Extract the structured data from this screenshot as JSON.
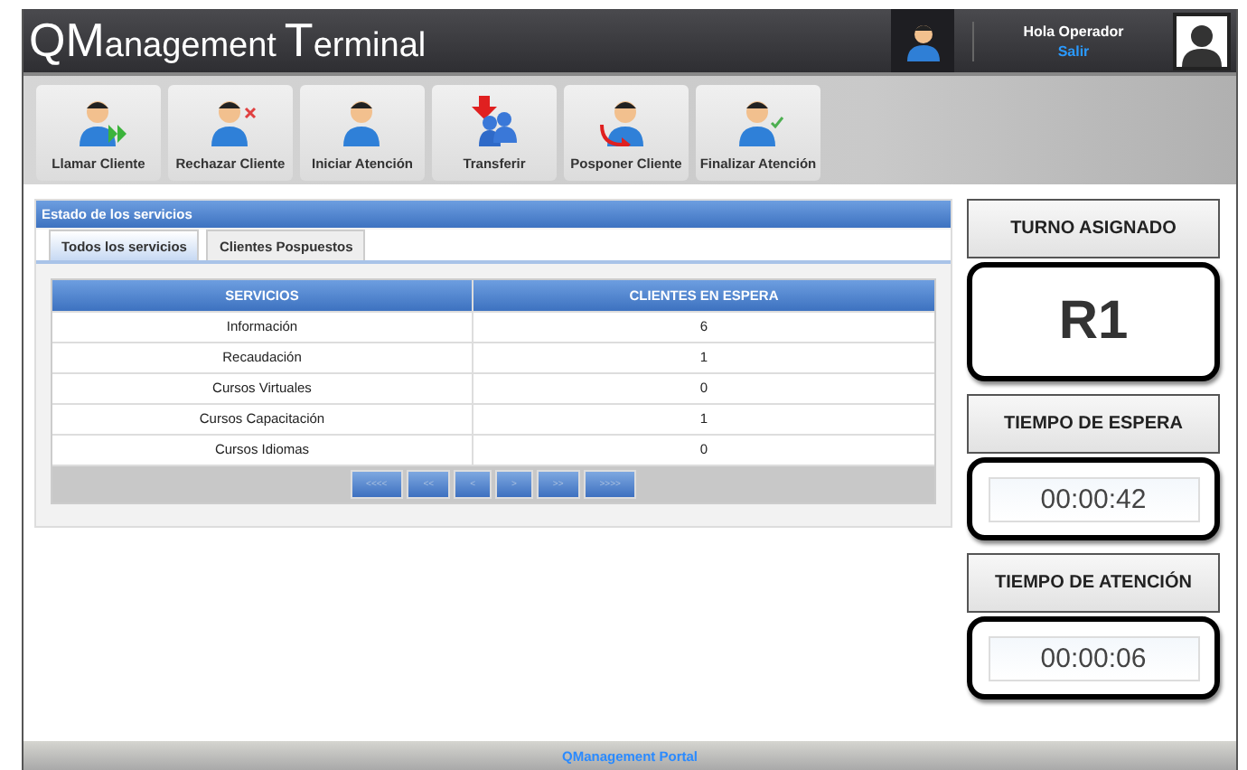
{
  "header": {
    "title": "QManagement Terminal",
    "greeting": "Hola Operador",
    "logout": "Salir"
  },
  "toolbar": [
    {
      "label": "Llamar Cliente",
      "kind": "call"
    },
    {
      "label": "Rechazar Cliente",
      "kind": "reject"
    },
    {
      "label": "Iniciar Atención",
      "kind": "start"
    },
    {
      "label": "Transferir",
      "kind": "transfer"
    },
    {
      "label": "Posponer Cliente",
      "kind": "postpone"
    },
    {
      "label": "Finalizar Atención",
      "kind": "finish"
    }
  ],
  "panel": {
    "title": "Estado de los servicios",
    "tabs": [
      {
        "label": "Todos los servicios",
        "selected": true
      },
      {
        "label": "Clientes Pospuestos",
        "selected": false
      }
    ],
    "table": {
      "columns": [
        "SERVICIOS",
        "CLIENTES EN ESPERA"
      ],
      "rows": [
        [
          "Información",
          "6"
        ],
        [
          "Recaudación",
          "1"
        ],
        [
          "Cursos Virtuales",
          "0"
        ],
        [
          "Cursos Capacitación",
          "1"
        ],
        [
          "Cursos Idiomas",
          "0"
        ]
      ]
    },
    "pager": [
      "<<<<",
      "<<",
      "<",
      ">",
      ">>",
      ">>>>"
    ]
  },
  "side": [
    {
      "label": "TURNO ASIGNADO",
      "value": "R1",
      "kind": "big"
    },
    {
      "label": "TIEMPO DE ESPERA",
      "value": "00:00:42",
      "kind": "time"
    },
    {
      "label": "TIEMPO DE ATENCIÓN",
      "value": "00:00:06",
      "kind": "time"
    }
  ],
  "footer": "QManagement Portal"
}
